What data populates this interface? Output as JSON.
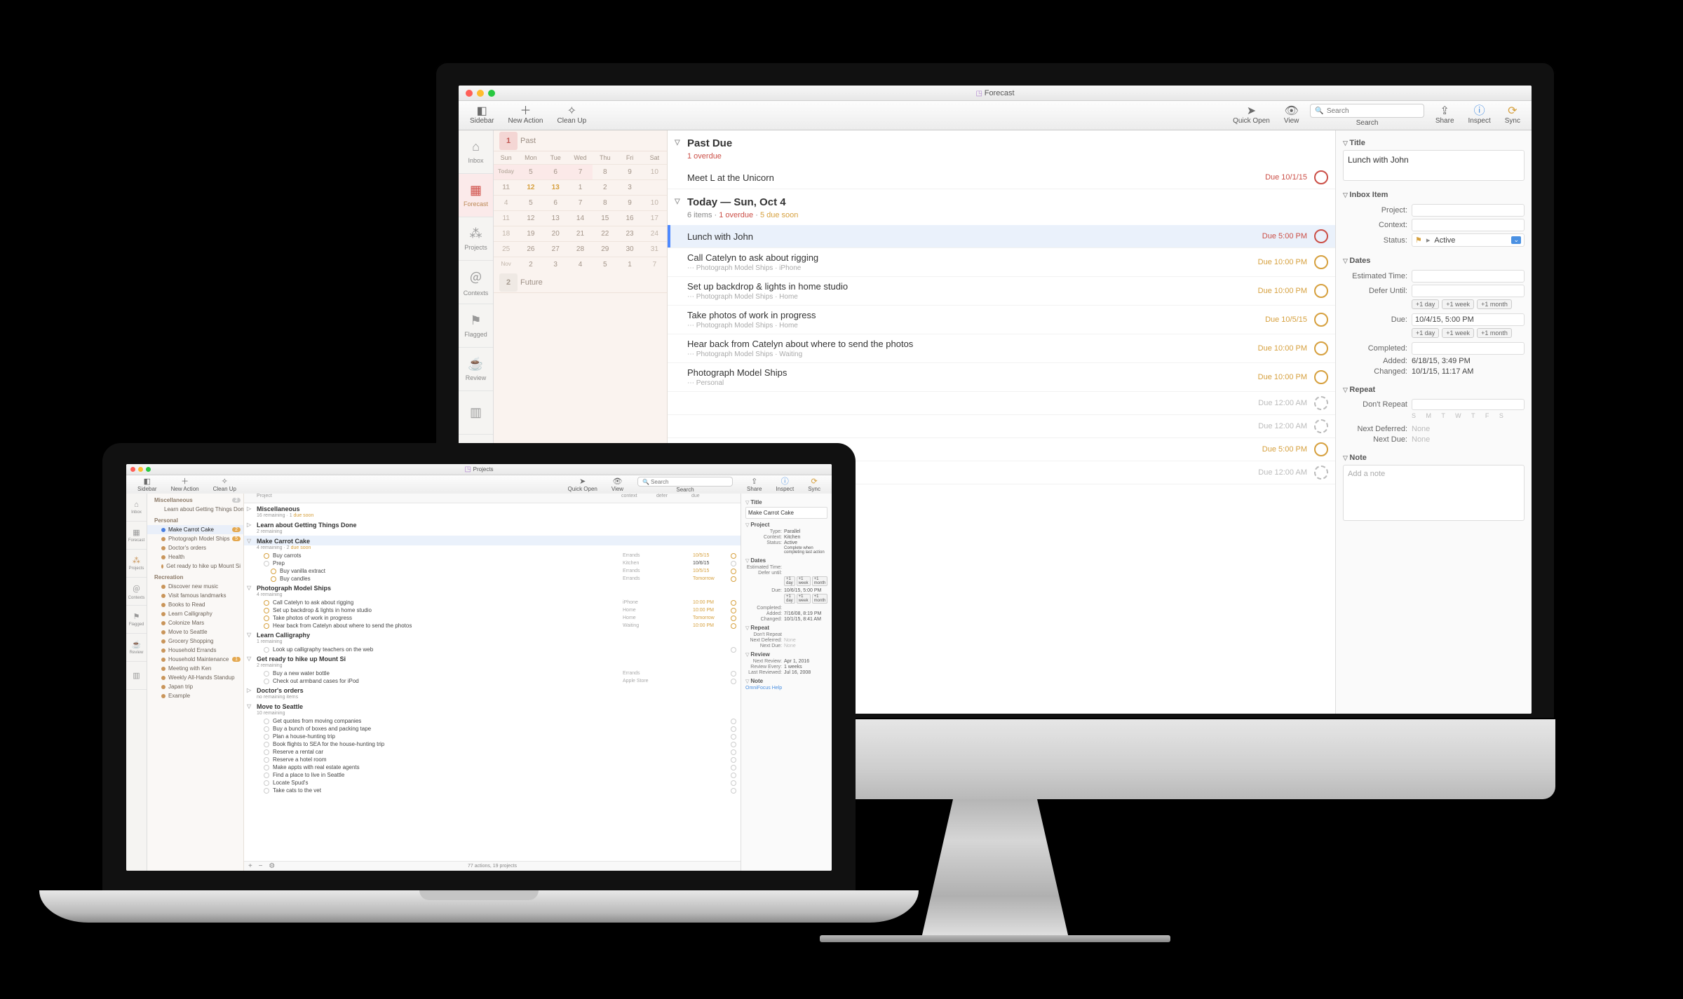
{
  "imac": {
    "window_title": "Forecast",
    "toolbar": {
      "sidebar": "Sidebar",
      "new_action": "New Action",
      "clean_up": "Clean Up",
      "quick_open": "Quick Open",
      "view": "View",
      "search_placeholder": "Search",
      "search_label": "Search",
      "share": "Share",
      "inspect": "Inspect",
      "sync": "Sync"
    },
    "tabs": {
      "inbox": "Inbox",
      "forecast": "Forecast",
      "projects": "Projects",
      "contexts": "Contexts",
      "flagged": "Flagged",
      "review": "Review"
    },
    "calendar": {
      "past_count": "1",
      "past_label": "Past",
      "future_count": "2",
      "future_label": "Future",
      "dow": [
        "Sun",
        "Mon",
        "Tue",
        "Wed",
        "Thu",
        "Fri",
        "Sat"
      ],
      "rows": [
        [
          "Today",
          "5",
          "6",
          "7",
          "8",
          "9",
          "10"
        ],
        [
          "11",
          "12",
          "13",
          "1",
          "2",
          "3",
          ""
        ],
        [
          "4",
          "5",
          "6",
          "7",
          "8",
          "9",
          "10"
        ],
        [
          "11",
          "12",
          "13",
          "14",
          "15",
          "16",
          "17"
        ],
        [
          "18",
          "19",
          "20",
          "21",
          "22",
          "23",
          "24"
        ],
        [
          "25",
          "26",
          "27",
          "28",
          "29",
          "30",
          "31"
        ],
        [
          "Nov",
          "2",
          "3",
          "4",
          "5",
          "1",
          "7"
        ]
      ]
    },
    "sections": {
      "past_due": {
        "title": "Past Due",
        "sub_overdue": "1 overdue"
      },
      "today": {
        "title": "Today — Sun, Oct 4",
        "sub_items": "6 items",
        "sub_overdue": "1 overdue",
        "sub_duesoon": "5 due soon"
      }
    },
    "tasks": [
      {
        "section": "past",
        "title": "Meet L at the Unicorn",
        "meta": "",
        "due": "Due 10/1/15",
        "color": "red"
      },
      {
        "section": "today",
        "title": "Lunch with John",
        "meta": "",
        "due": "Due 5:00 PM",
        "color": "red",
        "selected": true
      },
      {
        "section": "today",
        "title": "Call Catelyn to ask about rigging",
        "meta": "Photograph Model Ships · iPhone",
        "due": "Due 10:00 PM",
        "color": "amber"
      },
      {
        "section": "today",
        "title": "Set up backdrop & lights in home studio",
        "meta": "Photograph Model Ships · Home",
        "due": "Due 10:00 PM",
        "color": "amber"
      },
      {
        "section": "today",
        "title": "Take photos of work in progress",
        "meta": "Photograph Model Ships · Home",
        "due": "Due 10/5/15",
        "color": "amber"
      },
      {
        "section": "today",
        "title": "Hear back from Catelyn about where to send the photos",
        "meta": "Photograph Model Ships · Waiting",
        "due": "Due 10:00 PM",
        "color": "amber"
      },
      {
        "section": "today",
        "title": "Photograph Model Ships",
        "meta": "Personal",
        "due": "Due 10:00 PM",
        "color": "amber"
      },
      {
        "section": "today",
        "title": "",
        "meta": "",
        "due": "Due 12:00 AM",
        "color": "grey"
      },
      {
        "section": "today",
        "title": "",
        "meta": "",
        "due": "Due 12:00 AM",
        "color": "grey"
      },
      {
        "section": "today",
        "title": "",
        "meta": "",
        "due": "Due 5:00 PM",
        "color": "amber"
      },
      {
        "section": "today",
        "title": "",
        "meta": "",
        "due": "Due 12:00 AM",
        "color": "grey"
      }
    ],
    "inspector": {
      "title_hdr": "Title",
      "title_value": "Lunch with John",
      "inbox_hdr": "Inbox Item",
      "project_lbl": "Project:",
      "context_lbl": "Context:",
      "status_lbl": "Status:",
      "status_val": "Active",
      "dates_hdr": "Dates",
      "est_lbl": "Estimated Time:",
      "defer_lbl": "Defer Until:",
      "due_lbl": "Due:",
      "due_val": "10/4/15, 5:00 PM",
      "completed_lbl": "Completed:",
      "added_lbl": "Added:",
      "added_val": "6/18/15, 3:49 PM",
      "changed_lbl": "Changed:",
      "changed_val": "10/1/15, 11:17 AM",
      "qd_day": "+1 day",
      "qd_week": "+1 week",
      "qd_month": "+1 month",
      "repeat_hdr": "Repeat",
      "repeat_val": "Don't Repeat",
      "dow_letters": "S M T W T F S",
      "next_def_lbl": "Next Deferred:",
      "next_due_lbl": "Next Due:",
      "none": "None",
      "note_hdr": "Note",
      "note_placeholder": "Add a note"
    }
  },
  "macbook": {
    "window_title": "Projects",
    "toolbar": {
      "sidebar": "Sidebar",
      "new_action": "New Action",
      "clean_up": "Clean Up",
      "quick_open": "Quick Open",
      "view": "View",
      "search_placeholder": "Search",
      "search_label": "Search",
      "share": "Share",
      "inspect": "Inspect",
      "sync": "Sync"
    },
    "tabs": {
      "inbox": "Inbox",
      "forecast": "Forecast",
      "projects": "Projects",
      "contexts": "Contexts",
      "flagged": "Flagged",
      "review": "Review"
    },
    "sidebar": [
      {
        "label": "Miscellaneous",
        "h": true,
        "badge": "2",
        "badgeCls": "g"
      },
      {
        "label": "Learn about Getting Things Done",
        "sub": true
      },
      {
        "label": "Personal",
        "h": true
      },
      {
        "label": "Make Carrot Cake",
        "sub": true,
        "sel": true,
        "badge": "2"
      },
      {
        "label": "Photograph Model Ships",
        "sub": true,
        "badge": "5"
      },
      {
        "label": "Doctor's orders",
        "sub": true
      },
      {
        "label": "Health",
        "sub": true
      },
      {
        "label": "Get ready to hike up Mount Si",
        "sub": true
      },
      {
        "label": "Recreation",
        "h": true
      },
      {
        "label": "Discover new music",
        "sub": true
      },
      {
        "label": "Visit famous landmarks",
        "sub": true
      },
      {
        "label": "Books to Read",
        "sub": true
      },
      {
        "label": "Learn Calligraphy",
        "sub": true
      },
      {
        "label": "Colonize Mars",
        "sub": true
      },
      {
        "label": "Move to Seattle",
        "sub": true
      },
      {
        "label": "Grocery Shopping",
        "sub": true
      },
      {
        "label": "Household Errands",
        "sub": true
      },
      {
        "label": "Household Maintenance",
        "sub": true,
        "badge": "1"
      },
      {
        "label": "Meeting with Ken",
        "sub": true
      },
      {
        "label": "Weekly All-Hands Standup",
        "sub": true
      },
      {
        "label": "Japan trip",
        "sub": true
      },
      {
        "label": "Example",
        "sub": true
      }
    ],
    "columns": {
      "project": "Project",
      "context": "context",
      "defer": "defer",
      "due": "due"
    },
    "groups": [
      {
        "title": "Miscellaneous",
        "sub": "16 remaining · 1 due soon",
        "rows": []
      },
      {
        "title": "Learn about Getting Things Done",
        "sub": "2 remaining",
        "rows": []
      },
      {
        "title": "Make Carrot Cake",
        "sub": "4 remaining · 2 due soon",
        "open": true,
        "sel": true,
        "ctx": "Kitchen",
        "due": "10/6/15",
        "rows": [
          {
            "t": "Buy carrots",
            "ctx": "Errands",
            "due": "10/5/15",
            "dueCls": "amber"
          },
          {
            "t": "Prep",
            "ctx": "Kitchen",
            "due": "10/6/15",
            "sub": false,
            "grp": true
          },
          {
            "t": "Buy vanilla extract",
            "ctx": "Errands",
            "due": "10/5/15",
            "dueCls": "amber",
            "sub": true
          },
          {
            "t": "Buy candles",
            "ctx": "Errands",
            "due": "Tomorrow",
            "dueCls": "tm",
            "sub": true
          }
        ]
      },
      {
        "title": "Photograph Model Ships",
        "sub": "4 remaining",
        "open": true,
        "due": "10:00 PM",
        "rows": [
          {
            "t": "Call Catelyn to ask about rigging",
            "ctx": "iPhone",
            "due": "10:00 PM",
            "dueCls": "amber",
            "flag": true
          },
          {
            "t": "Set up backdrop & lights in home studio",
            "ctx": "Home",
            "due": "10:00 PM",
            "dueCls": "amber"
          },
          {
            "t": "Take photos of work in progress",
            "ctx": "Home",
            "due": "Tomorrow",
            "dueCls": "tm"
          },
          {
            "t": "Hear back from Catelyn about where to send the photos",
            "ctx": "Waiting",
            "due": "10:00 PM",
            "dueCls": "amber"
          }
        ]
      },
      {
        "title": "Learn Calligraphy",
        "sub": "1 remaining",
        "open": true,
        "rows": [
          {
            "t": "Look up calligraphy teachers on the web",
            "ctx": "",
            "due": ""
          }
        ]
      },
      {
        "title": "Get ready to hike up Mount Si",
        "sub": "2 remaining",
        "open": true,
        "rows": [
          {
            "t": "Buy a new water bottle",
            "ctx": "Errands",
            "due": ""
          },
          {
            "t": "Check out armband cases for iPod",
            "ctx": "Apple Store",
            "due": ""
          }
        ]
      },
      {
        "title": "Doctor's orders",
        "sub": "no remaining items",
        "rows": []
      },
      {
        "title": "Move to Seattle",
        "sub": "10 remaining",
        "open": true,
        "rows": [
          {
            "t": "Get quotes from moving companies",
            "ctx": "",
            "due": "",
            "flag": true
          },
          {
            "t": "Buy a bunch of boxes and packing tape",
            "ctx": "",
            "due": ""
          },
          {
            "t": "Plan a house-hunting trip",
            "ctx": "",
            "due": ""
          },
          {
            "t": "Book flights to SEA for the house-hunting trip",
            "ctx": "",
            "due": ""
          },
          {
            "t": "Reserve a rental car",
            "ctx": "",
            "due": ""
          },
          {
            "t": "Reserve a hotel room",
            "ctx": "",
            "due": ""
          },
          {
            "t": "Make appts with real estate agents",
            "ctx": "",
            "due": ""
          },
          {
            "t": "Find a place to live in Seattle",
            "ctx": "",
            "due": ""
          },
          {
            "t": "Locate Spud's",
            "ctx": "",
            "due": ""
          },
          {
            "t": "Take cats to the vet",
            "ctx": "",
            "due": ""
          }
        ]
      }
    ],
    "footer": "77 actions, 19 projects",
    "inspector": {
      "title_hdr": "Title",
      "title_value": "Make Carrot Cake",
      "project_hdr": "Project",
      "type_lbl": "Type:",
      "type_val": "Parallel",
      "context_lbl": "Context:",
      "context_val": "Kitchen",
      "status_lbl": "Status:",
      "status_val": "Active",
      "complete_chk": "Complete when completing last action",
      "dates_hdr": "Dates",
      "est_lbl": "Estimated Time:",
      "defer_lbl": "Defer until:",
      "qd_day": "+1 day",
      "qd_week": "+1 week",
      "qd_month": "+1 month",
      "due_lbl": "Due:",
      "due_val": "10/6/15, 5:00 PM",
      "completed_lbl": "Completed:",
      "added_lbl": "Added:",
      "added_val": "7/16/08, 8:19 PM",
      "changed_lbl": "Changed:",
      "changed_val": "10/1/15, 8:41 AM",
      "repeat_hdr": "Repeat",
      "repeat_val": "Don't Repeat",
      "next_def_lbl": "Next Deferred:",
      "next_due_lbl": "Next Due:",
      "none": "None",
      "review_hdr": "Review",
      "next_review_lbl": "Next Review:",
      "next_review_val": "Apr 1, 2016",
      "review_every_lbl": "Review Every:",
      "review_every_val": "1   weeks",
      "last_reviewed_lbl": "Last Reviewed:",
      "last_reviewed_val": "Jul 16, 2008",
      "note_hdr": "Note",
      "note_link": "OmniFocus Help"
    }
  }
}
